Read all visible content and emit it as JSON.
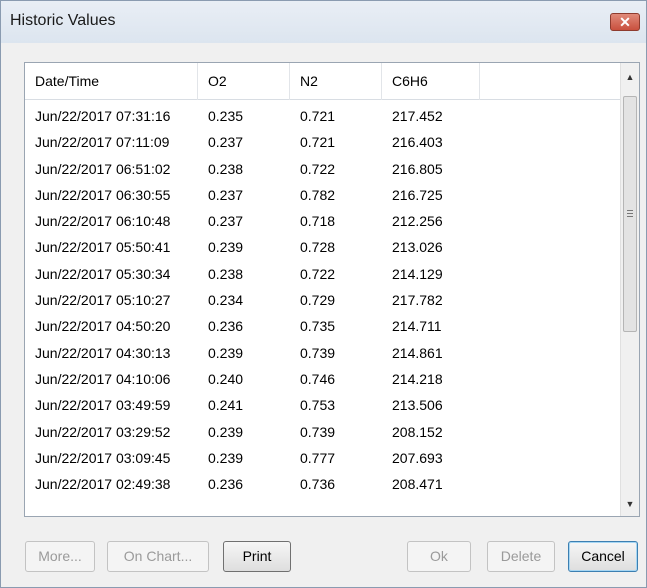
{
  "window": {
    "title": "Historic Values",
    "close_label": "✕"
  },
  "table": {
    "columns": [
      "Date/Time",
      "O2",
      "N2",
      "C6H6",
      ""
    ],
    "rows": [
      [
        "Jun/22/2017 07:31:16",
        "0.235",
        "0.721",
        "217.452"
      ],
      [
        "Jun/22/2017 07:11:09",
        "0.237",
        "0.721",
        "216.403"
      ],
      [
        "Jun/22/2017 06:51:02",
        "0.238",
        "0.722",
        "216.805"
      ],
      [
        "Jun/22/2017 06:30:55",
        "0.237",
        "0.782",
        "216.725"
      ],
      [
        "Jun/22/2017 06:10:48",
        "0.237",
        "0.718",
        "212.256"
      ],
      [
        "Jun/22/2017 05:50:41",
        "0.239",
        "0.728",
        "213.026"
      ],
      [
        "Jun/22/2017 05:30:34",
        "0.238",
        "0.722",
        "214.129"
      ],
      [
        "Jun/22/2017 05:10:27",
        "0.234",
        "0.729",
        "217.782"
      ],
      [
        "Jun/22/2017 04:50:20",
        "0.236",
        "0.735",
        "214.711"
      ],
      [
        "Jun/22/2017 04:30:13",
        "0.239",
        "0.739",
        "214.861"
      ],
      [
        "Jun/22/2017 04:10:06",
        "0.240",
        "0.746",
        "214.218"
      ],
      [
        "Jun/22/2017 03:49:59",
        "0.241",
        "0.753",
        "213.506"
      ],
      [
        "Jun/22/2017 03:29:52",
        "0.239",
        "0.739",
        "208.152"
      ],
      [
        "Jun/22/2017 03:09:45",
        "0.239",
        "0.777",
        "207.693"
      ],
      [
        "Jun/22/2017 02:49:38",
        "0.236",
        "0.736",
        "208.471"
      ]
    ]
  },
  "scrollbar": {
    "up_icon": "scroll-up-arrow-icon",
    "down_icon": "scroll-down-arrow-icon"
  },
  "buttons": {
    "more": "More...",
    "on_chart": "On Chart...",
    "print": "Print",
    "ok": "Ok",
    "delete": "Delete",
    "cancel": "Cancel"
  }
}
